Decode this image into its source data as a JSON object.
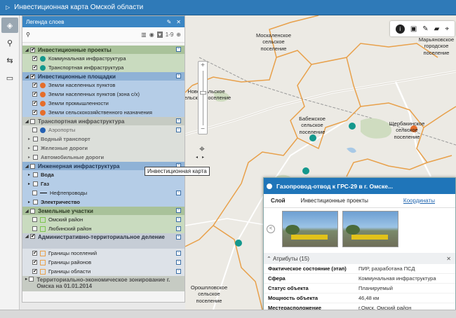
{
  "app": {
    "title": "Инвестиционная карта Омской области"
  },
  "left_toolbar": [
    {
      "icon": "layers-icon",
      "glyph": "◈",
      "active": true
    },
    {
      "icon": "search-icon",
      "glyph": "⚲",
      "active": false
    },
    {
      "icon": "route-icon",
      "glyph": "⇆",
      "active": false
    },
    {
      "icon": "transport-icon",
      "glyph": "▭",
      "active": false
    }
  ],
  "legend": {
    "title": "Легенда слоев",
    "range_label": "1-9",
    "groups": [
      {
        "label": "Инвестиционные проекты",
        "color": "green",
        "checked": true,
        "expanded": true,
        "items": [
          {
            "label": "Коммунальная инфраструктура",
            "symbol": "pin-teal",
            "checked": true
          },
          {
            "label": "Транспортная инфраструктура",
            "symbol": "pin-teal",
            "checked": true
          }
        ]
      },
      {
        "label": "Инвестиционные площадки",
        "color": "blue",
        "checked": true,
        "expanded": true,
        "items": [
          {
            "label": "Земли населенных пунктов",
            "symbol": "pin-orange",
            "checked": true
          },
          {
            "label": "Земли населенных пунктов (зона с/х)",
            "symbol": "pin-orange",
            "checked": true
          },
          {
            "label": "Земли промышленности",
            "symbol": "pin-orange",
            "checked": true
          },
          {
            "label": "Земли сельскохозяйственного назначения",
            "symbol": "pin-orange",
            "checked": true
          }
        ]
      },
      {
        "label": "Транспортная инфраструктура",
        "color": "gray",
        "checked": false,
        "expanded": true,
        "items": [
          {
            "label": "Аэропорты",
            "symbol": "pin-blue",
            "checked": false,
            "ctrl": true
          },
          {
            "label": "Водный транспорт",
            "bold": true,
            "checked": false,
            "tri": true
          },
          {
            "label": "Железные дороги",
            "bold": true,
            "checked": false,
            "tri": true
          },
          {
            "label": "Автомобильные дороги",
            "bold": true,
            "checked": false,
            "tri": true
          }
        ]
      },
      {
        "label": "Инженерная инфраструктура",
        "color": "blue",
        "checked": false,
        "expanded": true,
        "items": [
          {
            "label": "Вода",
            "bold": true,
            "checked": false,
            "tri": true
          },
          {
            "label": "Газ",
            "bold": true,
            "checked": false,
            "tri": true
          },
          {
            "label": "Нефтепроводы",
            "symbol": "line",
            "checked": false,
            "ctrl": true
          },
          {
            "label": "Электричество",
            "bold": true,
            "checked": false,
            "tri": true
          }
        ]
      },
      {
        "label": "Земельные участки",
        "color": "green",
        "checked": false,
        "expanded": true,
        "items": [
          {
            "label": "Омский район",
            "symbol": "sw-green",
            "checked": false,
            "ctrl": true
          },
          {
            "label": "Любинский район",
            "symbol": "sw-green",
            "checked": false,
            "ctrl": true
          }
        ]
      },
      {
        "label": "Административно-территориальное деление",
        "color": "dgray",
        "checked": true,
        "expanded": true,
        "items": [
          {
            "label": "Границы поселений",
            "symbol": "sw-orange",
            "checked": true,
            "ctrl": true
          },
          {
            "label": "Границы районов",
            "symbol": "sw-orange",
            "checked": true,
            "ctrl": true
          },
          {
            "label": "Границы области",
            "symbol": "sw-orange",
            "checked": true,
            "ctrl": true
          }
        ]
      },
      {
        "label": "Территориально-экономическое зонирование г. Омска на 01.01.2014",
        "color": "gray",
        "checked": false,
        "expanded": false,
        "items": []
      }
    ]
  },
  "map": {
    "labels": [
      "Москаленское сельское поселение",
      "Новоуральское сельское поселение",
      "Бабежское сельское поселение",
      "Щербакинское сельское поселение",
      "Марьяновское городское поселение",
      "Орошпловское сельское поселение"
    ],
    "tooltip": "Инвестиционная карта"
  },
  "popup": {
    "title": "Газопровод-отвод к ГРС-29 в г. Омске...",
    "tabs": [
      "Слой",
      "Инвестиционные проекты",
      "Координаты"
    ],
    "attributes_title": "Атрибуты (15)",
    "attributes": [
      {
        "key": "Фактическое состояние (этап)",
        "value": "ПИР, разработана ПСД"
      },
      {
        "key": "Сфера",
        "value": "Коммунальная инфраструктура"
      },
      {
        "key": "Статус объекта",
        "value": "Планируемый"
      },
      {
        "key": "Мощность объекта",
        "value": "46,48 км"
      },
      {
        "key": "Местерасположение",
        "value": "г.Омск, Омский район"
      }
    ]
  },
  "colors": {
    "header_blue": "#2f7ab8",
    "boundary_orange": "#e8a04a",
    "pin_teal": "#14988d",
    "pin_orange": "#e56e2b"
  }
}
